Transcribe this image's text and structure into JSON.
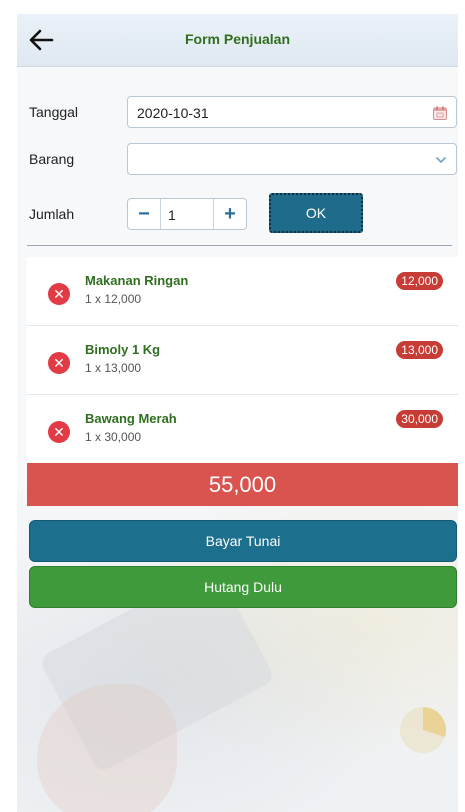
{
  "header": {
    "title": "Form Penjualan"
  },
  "form": {
    "tanggal_label": "Tanggal",
    "tanggal_value": "2020-10-31",
    "barang_label": "Barang",
    "barang_value": "",
    "jumlah_label": "Jumlah",
    "jumlah_value": "1",
    "minus_label": "−",
    "plus_label": "+",
    "ok_label": "OK"
  },
  "items": [
    {
      "name": "Makanan Ringan",
      "detail": "1 x 12,000",
      "price": "12,000"
    },
    {
      "name": "Bimoly 1 Kg",
      "detail": "1 x 13,000",
      "price": "13,000"
    },
    {
      "name": "Bawang Merah",
      "detail": "1 x 30,000",
      "price": "30,000"
    }
  ],
  "total": "55,000",
  "actions": {
    "cash_label": "Bayar Tunai",
    "debt_label": "Hutang Dulu"
  },
  "colors": {
    "accent_blue": "#1d6f8e",
    "accent_green": "#3e9a3a",
    "total_red": "#d9534f",
    "title_green": "#2f6f1f"
  },
  "icons": {
    "back": "arrow-left-icon",
    "calendar": "calendar-icon",
    "dropdown": "chevron-down-icon",
    "remove": "close-circle-icon"
  }
}
